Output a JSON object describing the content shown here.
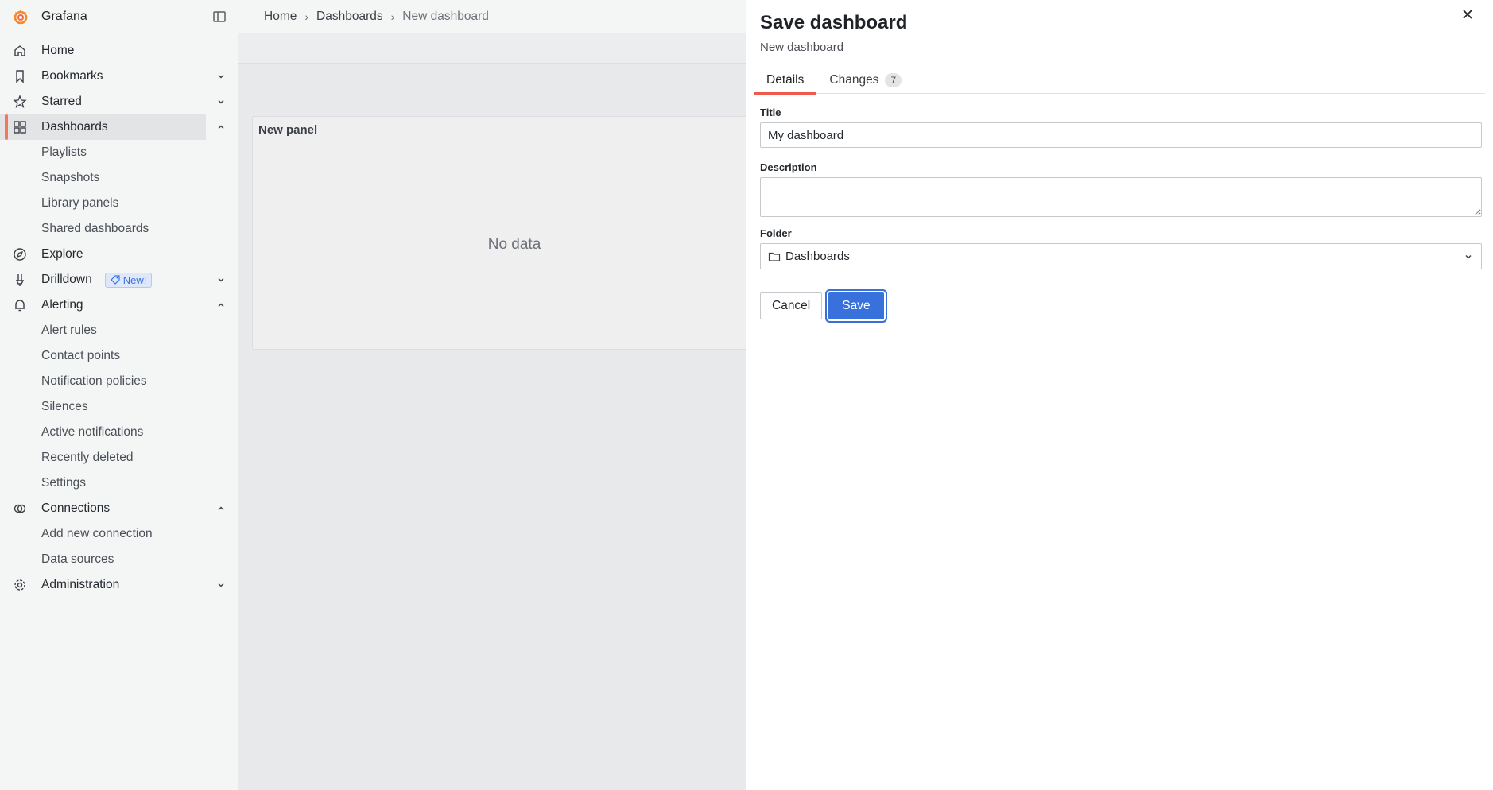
{
  "app": {
    "brand": "Grafana"
  },
  "sidebar": {
    "items": [
      {
        "label": "Home",
        "icon": "home-icon"
      },
      {
        "label": "Bookmarks",
        "icon": "bookmark-icon"
      },
      {
        "label": "Starred",
        "icon": "star-icon"
      },
      {
        "label": "Dashboards",
        "icon": "apps-icon"
      },
      {
        "label": "Playlists"
      },
      {
        "label": "Snapshots"
      },
      {
        "label": "Library panels"
      },
      {
        "label": "Shared dashboards"
      },
      {
        "label": "Explore",
        "icon": "compass-icon"
      },
      {
        "label": "Drilldown",
        "icon": "drilldown-icon",
        "badge": "New!"
      },
      {
        "label": "Alerting",
        "icon": "bell-icon"
      },
      {
        "label": "Alert rules"
      },
      {
        "label": "Contact points"
      },
      {
        "label": "Notification policies"
      },
      {
        "label": "Silences"
      },
      {
        "label": "Active notifications"
      },
      {
        "label": "Recently deleted"
      },
      {
        "label": "Settings"
      },
      {
        "label": "Connections",
        "icon": "connections-icon"
      },
      {
        "label": "Add new connection"
      },
      {
        "label": "Data sources"
      },
      {
        "label": "Administration",
        "icon": "cog-icon"
      }
    ]
  },
  "breadcrumb": {
    "home": "Home",
    "dashboards": "Dashboards",
    "current": "New dashboard"
  },
  "panel": {
    "title": "New panel",
    "empty": "No data"
  },
  "drawer": {
    "title": "Save dashboard",
    "subtitle": "New dashboard",
    "tabs": {
      "details": "Details",
      "changes": "Changes",
      "changes_count": "7"
    },
    "form": {
      "title_label": "Title",
      "title_value": "My dashboard",
      "description_label": "Description",
      "description_value": "",
      "folder_label": "Folder",
      "folder_value": "Dashboards"
    },
    "buttons": {
      "cancel": "Cancel",
      "save": "Save"
    }
  },
  "colors": {
    "accent": "#3871dc",
    "active_marker": "#f0795a",
    "tab_underline": "#f05a4e"
  }
}
